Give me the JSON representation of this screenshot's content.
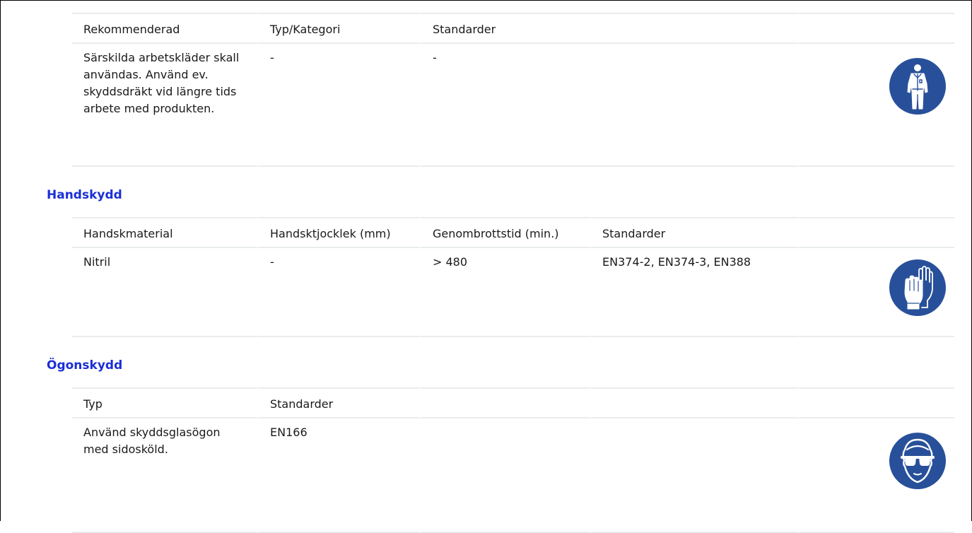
{
  "body_protection": {
    "headers": [
      "Rekommenderad",
      "Typ/Kategori",
      "Standarder",
      "",
      ""
    ],
    "row": [
      "Särskilda arbetskläder skall användas. Använd ev. skyddsdräkt vid längre tids arbete med produkten.",
      "-",
      "-",
      "",
      ""
    ],
    "icon": "protective-clothing-icon"
  },
  "hand_protection": {
    "title": "Handskydd",
    "headers": [
      "Handskmaterial",
      "Handsktjocklek (mm)",
      "Genombrottstid (min.)",
      "Standarder",
      ""
    ],
    "row": [
      "Nitril",
      "-",
      "> 480",
      "EN374-2, EN374-3, EN388",
      ""
    ],
    "icon": "gloves-icon"
  },
  "eye_protection": {
    "title": "Ögonskydd",
    "headers": [
      "Typ",
      "Standarder",
      "",
      "",
      ""
    ],
    "row": [
      "Använd skyddsglasögon med sidosköld.",
      "EN166",
      "",
      "",
      ""
    ],
    "icon": "safety-goggles-icon"
  },
  "colors": {
    "section_title": "#1a2fd6",
    "pictogram_bg": "#28509a",
    "pictogram_fg": "#ffffff",
    "table_rule": "#e9ecef"
  }
}
